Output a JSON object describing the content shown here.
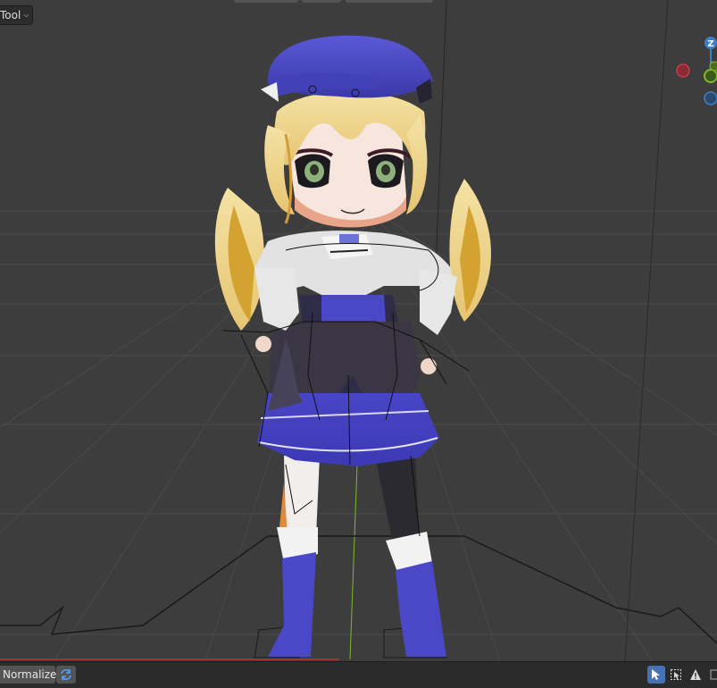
{
  "header": {
    "tool_menu_label": "Tool",
    "tool_menu_icon": "chevron-down-icon"
  },
  "gizmo": {
    "z_axis_label": "Z",
    "x_axis_color": "#c83d4c",
    "y_axis_color": "#7fb82a",
    "z_axis_color": "#3e80c4"
  },
  "bottom_bar": {
    "normalize_label": "Normalize",
    "refresh_icon": "refresh-icon",
    "tools": [
      {
        "name": "select-tool-icon",
        "active": true
      },
      {
        "name": "select-box-icon",
        "active": false
      },
      {
        "name": "warning-icon",
        "active": false
      },
      {
        "name": "box-icon",
        "active": false
      }
    ]
  },
  "colors": {
    "viewport_bg": "#3d3d3d",
    "grid_line": "#4a4a4a",
    "accent": "#4772b3"
  }
}
